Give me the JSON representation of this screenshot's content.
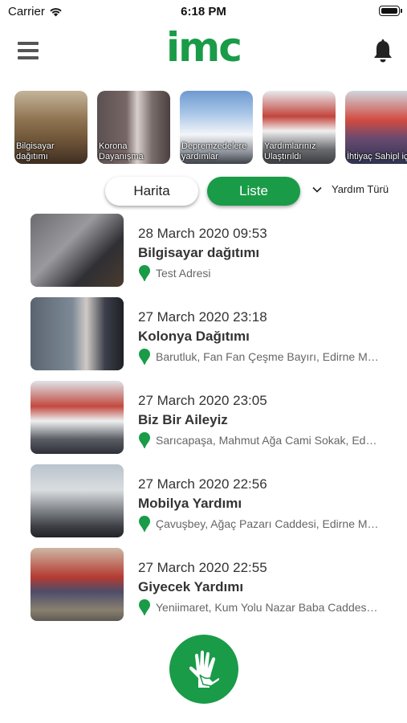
{
  "status_bar": {
    "carrier": "Carrier",
    "time": "6:18 PM",
    "wifi_icon": "wifi-icon",
    "battery_icon": "battery-icon"
  },
  "header": {
    "logo": "imc",
    "menu_icon": "hamburger-menu-icon",
    "bell_icon": "bell-icon"
  },
  "stories": [
    {
      "label": "Bilgisayar dağıtımı"
    },
    {
      "label": "Korona Dayanışma"
    },
    {
      "label": "Depremzedelere yardımlar"
    },
    {
      "label": "Yardımlarınız Ulaştırıldı"
    },
    {
      "label": "İhtiyaç Sahipl için"
    }
  ],
  "toggle": {
    "harita": "Harita",
    "liste": "Liste",
    "active": "Liste"
  },
  "filter": {
    "label": "Yardım Türü",
    "icon": "chevron-down-icon"
  },
  "list": [
    {
      "date": "28 March 2020 09:53",
      "title": "Bilgisayar dağıtımı",
      "address": "Test Adresi"
    },
    {
      "date": "27 March 2020 23:18",
      "title": "Kolonya Dağıtımı",
      "address": "Barutluk, Fan Fan Çeşme Bayırı, Edirne Merkez/Edirne"
    },
    {
      "date": "27 March 2020 23:05",
      "title": "Biz Bir Aileyiz",
      "address": "Sarıcapaşa, Mahmut Ağa Cami Sokak, Edirne Merkez/Edirne"
    },
    {
      "date": "27 March 2020 22:56",
      "title": "Mobilya Yardımı",
      "address": "Çavuşbey, Ağaç Pazarı Caddesi, Edirne Merkez/Edirne"
    },
    {
      "date": "27 March 2020 22:55",
      "title": "Giyecek Yardımı",
      "address": "Yeniimaret, Kum Yolu Nazar Baba Caddesi, Edirne"
    }
  ],
  "fab": {
    "icon": "helping-hand-icon"
  },
  "colors": {
    "accent": "#1a9b48",
    "text": "#333333",
    "muted": "#666666"
  }
}
